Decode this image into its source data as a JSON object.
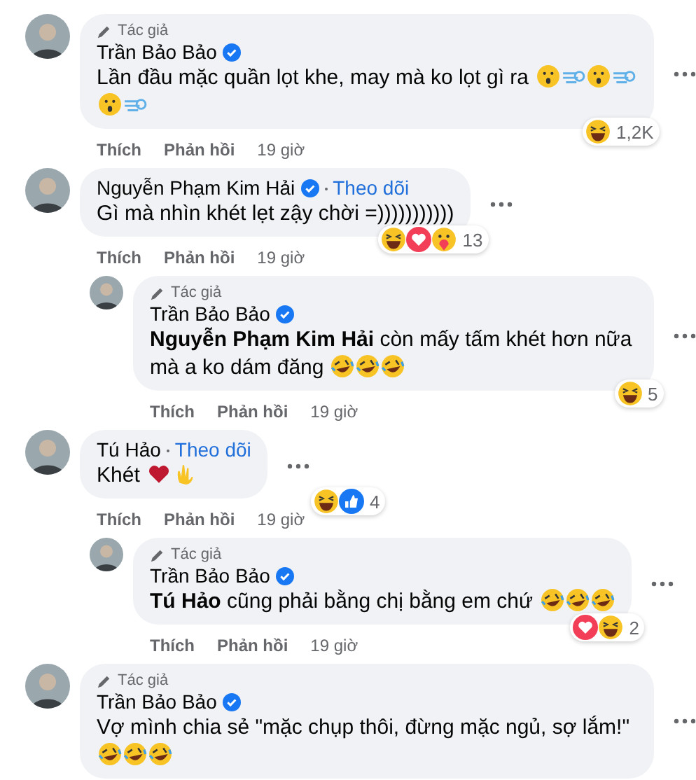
{
  "comments": [
    {
      "author_label": "Tác giả",
      "author": "Trần Bảo Bảo",
      "verified": true,
      "text": "Lần đầu mặc quần lọt khe, may mà ko lọt gì ra",
      "emojis": [
        {
          "kind": "surprised"
        },
        {
          "kind": "dash"
        },
        {
          "kind": "surprised"
        },
        {
          "kind": "dash"
        },
        {
          "kind": "surprised"
        },
        {
          "kind": "dash"
        }
      ],
      "reactions": {
        "icons": [
          {
            "kind": "haha"
          }
        ],
        "count": "1,2K"
      },
      "actions": [
        "Thích",
        "Phản hồi"
      ],
      "time": "19 giờ"
    },
    {
      "author": "Nguyễn Phạm Kim Hải",
      "verified": true,
      "follow": "Theo dõi",
      "text": "Gì mà nhìn khét lẹt zậy chời =)))))))))))",
      "reactions": {
        "icons": [
          {
            "kind": "haha"
          },
          {
            "kind": "love"
          },
          {
            "kind": "care"
          }
        ],
        "count": "13"
      },
      "actions": [
        "Thích",
        "Phản hồi"
      ],
      "time": "19 giờ",
      "replies": [
        {
          "author_label": "Tác giả",
          "author": "Trần Bảo Bảo",
          "verified": true,
          "mention": "Nguyễn Phạm Kim Hải",
          "text": "còn mấy tấm khét hơn nữa mà a ko dám đăng",
          "emojis": [
            {
              "kind": "rofl"
            },
            {
              "kind": "rofl"
            },
            {
              "kind": "rofl"
            }
          ],
          "reactions": {
            "icons": [
              {
                "kind": "haha"
              }
            ],
            "count": "5"
          },
          "actions": [
            "Thích",
            "Phản hồi"
          ],
          "time": "19 giờ"
        }
      ]
    },
    {
      "author": "Tú Hảo",
      "verified": false,
      "follow": "Theo dõi",
      "text": "Khét",
      "emojis": [
        {
          "kind": "heart"
        },
        {
          "kind": "hand"
        }
      ],
      "reactions": {
        "icons": [
          {
            "kind": "haha"
          },
          {
            "kind": "like"
          }
        ],
        "count": "4"
      },
      "actions": [
        "Thích",
        "Phản hồi"
      ],
      "time": "19 giờ",
      "replies": [
        {
          "author_label": "Tác giả",
          "author": "Trần Bảo Bảo",
          "verified": true,
          "mention": "Tú Hảo",
          "text": "cũng phải bằng chị bằng em chứ",
          "emojis": [
            {
              "kind": "rofl"
            },
            {
              "kind": "rofl"
            },
            {
              "kind": "rofl"
            }
          ],
          "reactions": {
            "icons": [
              {
                "kind": "love"
              },
              {
                "kind": "haha"
              }
            ],
            "count": "2"
          },
          "actions": [
            "Thích",
            "Phản hồi"
          ],
          "time": "19 giờ"
        }
      ]
    },
    {
      "author_label": "Tác giả",
      "author": "Trần Bảo Bảo",
      "verified": true,
      "text": "Vợ mình chia sẻ \"mặc chụp thôi, đừng mặc ngủ, sợ lắm!\"",
      "emojis": [
        {
          "kind": "rofl"
        },
        {
          "kind": "rofl"
        },
        {
          "kind": "rofl"
        }
      ]
    }
  ]
}
